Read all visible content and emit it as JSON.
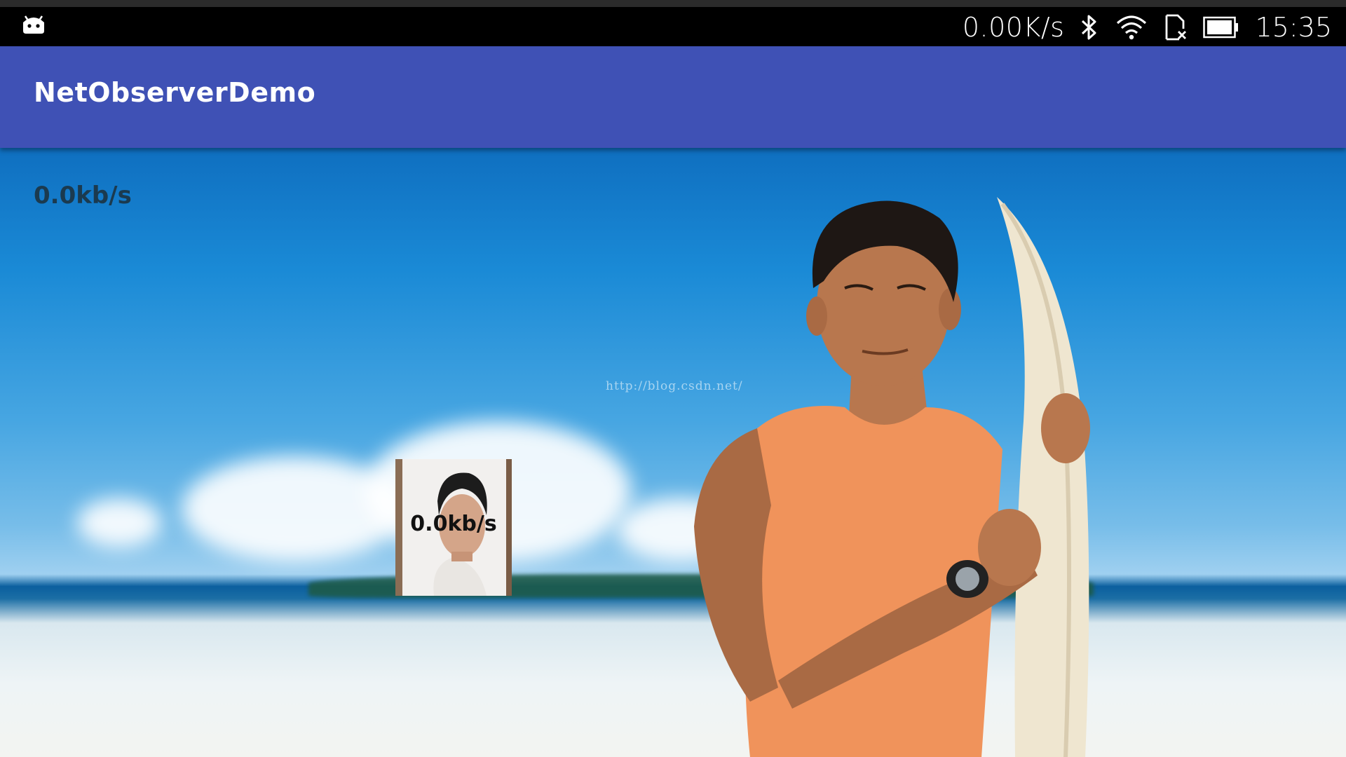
{
  "status_bar": {
    "net_speed": "0.00K/s",
    "clock": "15:35",
    "icons": [
      "android-debug-icon",
      "bluetooth-icon",
      "wifi-icon",
      "sim-missing-icon",
      "battery-icon"
    ]
  },
  "app_bar": {
    "title": "NetObserverDemo",
    "color": "#3f51b5"
  },
  "main": {
    "speed_label": "0.0kb/s",
    "watermark": "http://blog.csdn.net/"
  },
  "float_window": {
    "speed_label": "0.0kb/s"
  }
}
